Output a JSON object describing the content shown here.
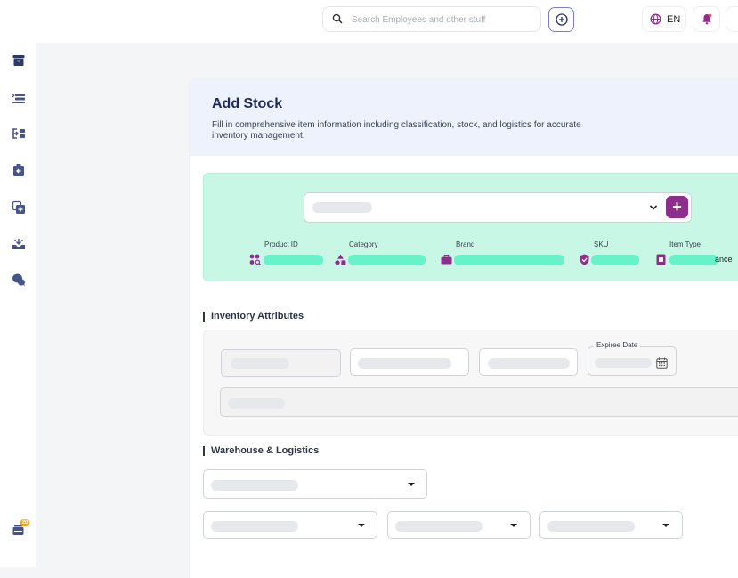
{
  "topbar": {
    "search_placeholder": "Search Employees and other stuff",
    "language": "EN"
  },
  "sidebar": {
    "icons": [
      "archive-icon",
      "stock-list-icon",
      "transfer-icon",
      "return-box-icon",
      "add-copy-icon",
      "inbox-tray-icon",
      "chat-bubbles-icon"
    ],
    "bottom_badge": "20"
  },
  "form": {
    "title": "Add Stock",
    "description": "Fill in comprehensive item information including classification, stock, and logistics for accurate inventory management.",
    "product_info": {
      "product_id_label": "Product ID",
      "category_label": "Category",
      "brand_label": "Brand",
      "sku_label": "SKU",
      "item_type_label": "Item Type",
      "overflow_text": "ance"
    },
    "inventory_section": {
      "title": "Inventory Attributes",
      "expire_date_label": "Expiree Date"
    },
    "warehouse_section": {
      "title": "Warehouse & Logistics"
    }
  },
  "colors": {
    "accent_purple": "#8e2d8c",
    "mint_bg": "#c9f7e6",
    "mint_bar": "#68f2c9",
    "header_bg": "#edf2fc"
  }
}
